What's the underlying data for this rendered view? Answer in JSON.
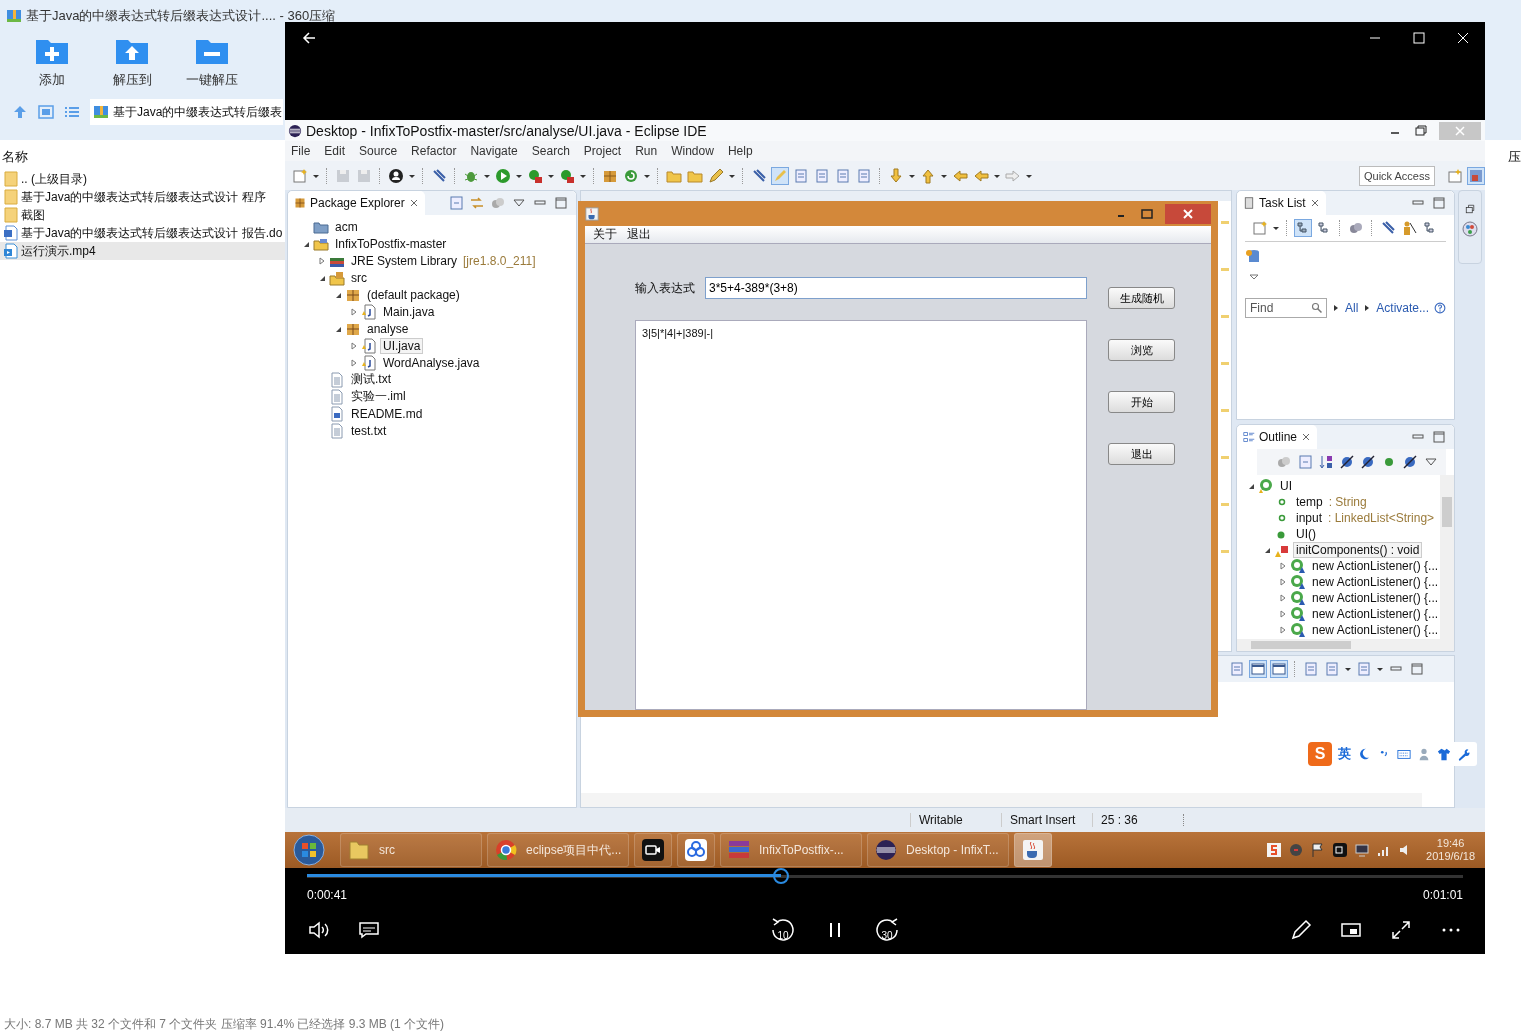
{
  "archiver": {
    "title": "基于Java的中缀表达式转后缀表达式设计.... - 360压缩",
    "toolbar": [
      {
        "label": "添加",
        "kind": "add"
      },
      {
        "label": "解压到",
        "kind": "extract"
      },
      {
        "label": "一键解压",
        "kind": "oneclick"
      }
    ],
    "address": "基于Java的中缀表达式转后缀表",
    "column_header": "名称",
    "column_2_partial": "压",
    "files": [
      {
        "name": ".. (上级目录)",
        "kind": "folder",
        "selected": false
      },
      {
        "name": "基于Java的中缀表达式转后缀表达式设计 程序",
        "kind": "folder",
        "selected": false
      },
      {
        "name": "截图",
        "kind": "folder",
        "selected": false
      },
      {
        "name": "基于Java的中缀表达式转后缀表达式设计 报告.do",
        "kind": "word",
        "selected": false
      },
      {
        "name": "运行演示.mp4",
        "kind": "video",
        "selected": true
      }
    ],
    "status": "大小: 8.7 MB 共 32 个文件和 7 个文件夹 压缩率 91.4% 已经选择 9.3 MB (1 个文件)"
  },
  "player": {
    "elapsed": "0:00:41",
    "duration": "0:01:01",
    "level": 0.41,
    "skip_back": "10",
    "skip_forward": "30",
    "eclipse": {
      "title": "Desktop - InfixToPostfix-master/src/analyse/UI.java - Eclipse IDE",
      "menu": [
        "File",
        "Edit",
        "Source",
        "Refactor",
        "Navigate",
        "Search",
        "Project",
        "Run",
        "Window",
        "Help"
      ],
      "quick_access": "Quick Access",
      "package_explorer": {
        "title": "Package Explorer",
        "tree": [
          {
            "label": "acm",
            "kind": "folder",
            "selected": false
          },
          {
            "label": "InfixToPostfix-master",
            "kind": "project",
            "selected": false,
            "expanded": true,
            "children": [
              {
                "label": "JRE System Library",
                "decoration": "[jre1.8.0_211]",
                "kind": "library",
                "selected": false,
                "expanded": false
              },
              {
                "label": "src",
                "kind": "source",
                "selected": false,
                "expanded": true,
                "children": [
                  {
                    "label": "(default package)",
                    "kind": "package",
                    "selected": false,
                    "expanded": true,
                    "children": [
                      {
                        "label": "Main.java",
                        "kind": "java",
                        "selected": false,
                        "expanded": false
                      }
                    ]
                  },
                  {
                    "label": "analyse",
                    "kind": "package",
                    "selected": false,
                    "expanded": true,
                    "children": [
                      {
                        "label": "UI.java",
                        "kind": "java",
                        "selected": true,
                        "expanded": false
                      },
                      {
                        "label": "WordAnalyse.java",
                        "kind": "java",
                        "selected": false,
                        "expanded": false
                      }
                    ]
                  }
                ]
              },
              {
                "label": "测试.txt",
                "kind": "text",
                "selected": false
              },
              {
                "label": "实验一.iml",
                "kind": "text",
                "selected": false
              },
              {
                "label": "README.md",
                "kind": "word",
                "selected": false
              },
              {
                "label": "test.txt",
                "kind": "text",
                "selected": false
              }
            ]
          }
        ]
      },
      "task_list": {
        "title": "Task List",
        "find_placeholder": "Find",
        "links": [
          "All",
          "Activate..."
        ]
      },
      "outline": {
        "title": "Outline",
        "tree": [
          {
            "label": "UI",
            "kind": "class",
            "selected": false,
            "expanded": true,
            "children": [
              {
                "label": "temp",
                "detail": ": String",
                "kind": "field",
                "selected": false
              },
              {
                "label": "input",
                "detail": ": LinkedList<String>",
                "kind": "field",
                "selected": false
              },
              {
                "label": "UI()",
                "kind": "constructor",
                "selected": false
              },
              {
                "label": "initComponents() : void",
                "kind": "method",
                "selected": true,
                "expanded": true,
                "children": [
                  {
                    "label": "new ActionListener() {...",
                    "kind": "anonymous",
                    "selected": false,
                    "expanded": false
                  },
                  {
                    "label": "new ActionListener() {...",
                    "kind": "anonymous",
                    "selected": false,
                    "expanded": false
                  },
                  {
                    "label": "new ActionListener() {...",
                    "kind": "anonymous",
                    "selected": false,
                    "expanded": false
                  },
                  {
                    "label": "new ActionListener() {...",
                    "kind": "anonymous",
                    "selected": false,
                    "expanded": false
                  },
                  {
                    "label": "new ActionListener() {...",
                    "kind": "anonymous",
                    "selected": false,
                    "expanded": false
                  }
                ]
              }
            ]
          }
        ]
      },
      "status": [
        "Writable",
        "Smart Insert",
        "25 : 36"
      ],
      "taskbar": {
        "items": [
          {
            "label": "src",
            "kind": "folder",
            "selected": false
          },
          {
            "label": "eclipse项目中代...",
            "kind": "chrome",
            "selected": false
          },
          {
            "kind": "video",
            "selected": false
          },
          {
            "kind": "cloud",
            "selected": false
          },
          {
            "label": "InfixToPostfix-...",
            "kind": "archive",
            "selected": false
          },
          {
            "label": "Desktop - InfixT...",
            "kind": "eclipse",
            "selected": false
          },
          {
            "kind": "java",
            "selected": true
          }
        ],
        "time": "19:46",
        "date": "2019/6/18"
      }
    }
  },
  "app_window": {
    "menu": [
      "关于",
      "退出"
    ],
    "input_label": "输入表达式",
    "input_value": "3*5+4-389*(3+8)",
    "output": "3|5|*|4|+|389|-|",
    "buttons": [
      "生成随机",
      "浏览",
      "开始",
      "退出"
    ]
  },
  "ime": {
    "logo": "S",
    "mode": "英"
  }
}
